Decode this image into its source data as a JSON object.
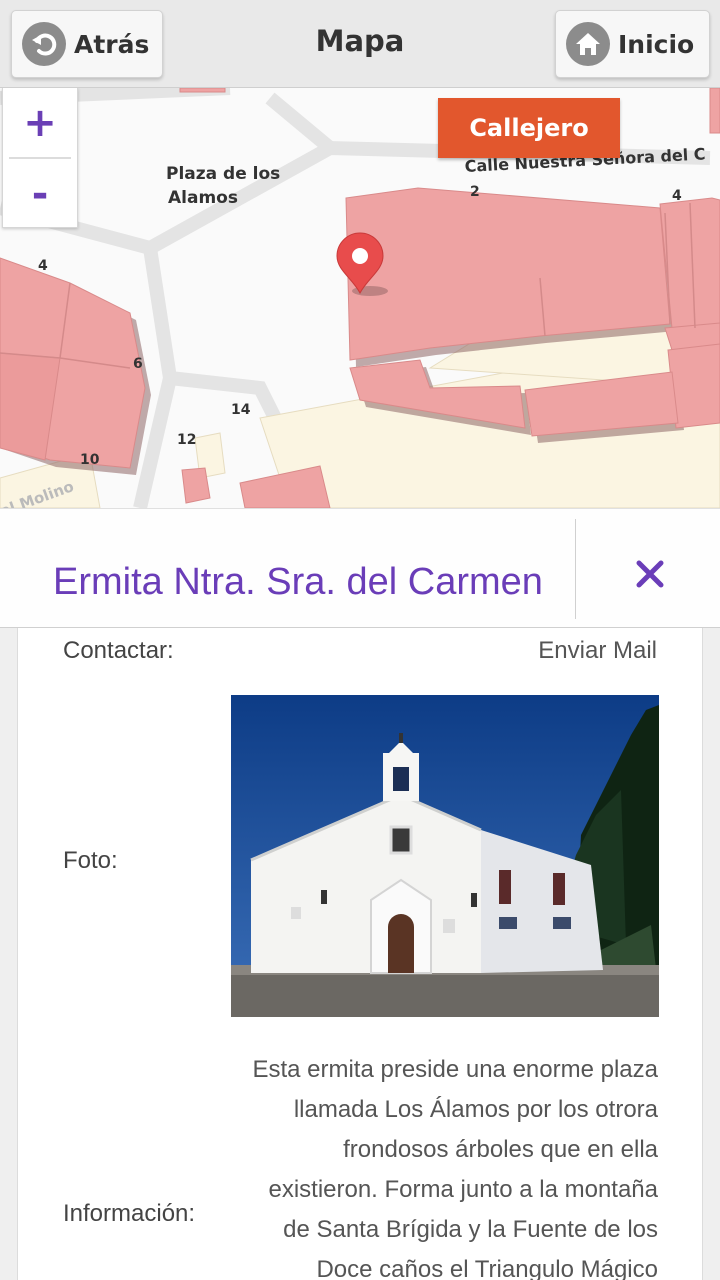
{
  "header": {
    "back_label": "Atrás",
    "title": "Mapa",
    "home_label": "Inicio",
    "back_icon": "back-arrow-icon",
    "home_icon": "home-icon"
  },
  "map": {
    "zoom_in": "+",
    "zoom_out": "-",
    "callejero_label": "Callejero",
    "labels": {
      "plaza_line1": "Plaza de los",
      "plaza_line2": "Alamos",
      "street": "Calle Nuestra Señora del C",
      "molino": "el Molino",
      "n2": "2",
      "n4a": "4",
      "n4b": "4",
      "n6": "6",
      "n14": "14",
      "n12": "12",
      "n10": "10"
    },
    "colors": {
      "building": "#eea3a3",
      "lot": "#fbf5e2",
      "marker": "#e84c4c",
      "accent": "#e2572d"
    }
  },
  "place": {
    "name": "Ermita Ntra. Sra. del Carmen",
    "close_icon": "close-icon",
    "accent_color": "#6a3db8"
  },
  "details": {
    "contact_label": "Contactar:",
    "contact_value": "Enviar Mail",
    "photo_label": "Foto:",
    "info_label": "Información:",
    "info_lines": [
      "Esta ermita preside una enorme plaza",
      "llamada Los Álamos por los otrora",
      "frondosos árboles que en ella",
      "existieron. Forma junto a la montaña",
      "de Santa Brígida y la Fuente de los",
      "Doce caños el Triangulo Mágico"
    ]
  }
}
